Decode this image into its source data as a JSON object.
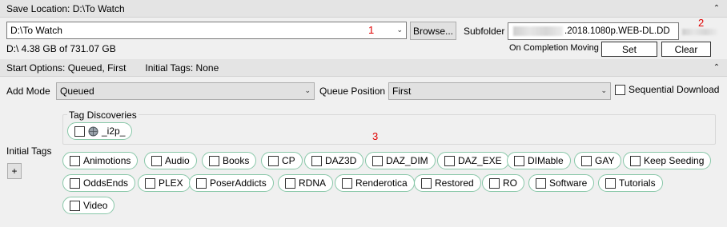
{
  "save_location": {
    "header": "Save Location: D:\\To Watch",
    "path_value": "D:\\To Watch",
    "disk_info": "D:\\  4.38 GB of 731.07 GB",
    "browse_label": "Browse...",
    "subfolder_label": "Subfolder",
    "subfolder_value": ".2018.1080p.WEB-DL.DD",
    "on_completion_label": "On Completion Moving",
    "set_label": "Set",
    "clear_label": "Clear",
    "marker_1": "1",
    "marker_2": "2"
  },
  "start_options": {
    "header": "Start Options: Queued, First",
    "initial_tags_header": "Initial Tags: None",
    "add_mode_label": "Add Mode",
    "add_mode_value": "Queued",
    "queue_position_label": "Queue Position",
    "queue_position_value": "First",
    "sequential_label": "Sequential Download"
  },
  "tags": {
    "initial_tags_label": "Initial Tags",
    "add_button": "+",
    "discoveries_label": "Tag Discoveries",
    "discovered_tag": "_i2p_",
    "marker_3": "3",
    "items": [
      "Animotions",
      "Audio",
      "Books",
      "CP",
      "DAZ3D",
      "DAZ_DIM",
      "DAZ_EXE",
      "DIMable",
      "GAY",
      "Keep Seeding",
      "OddsEnds",
      "PLEX",
      "PoserAddicts",
      "RDNA",
      "Renderotica",
      "Restored",
      "RO",
      "Software",
      "Tutorials",
      "Video"
    ]
  },
  "icons": {
    "collapse": "chevron-double-up-icon",
    "dropdown": "chevron-down-icon",
    "i2p": "network-globe-icon"
  },
  "colors": {
    "tag_border": "#88c7a8",
    "marker": "#e00000",
    "header_bg": "#e4e4e4"
  }
}
